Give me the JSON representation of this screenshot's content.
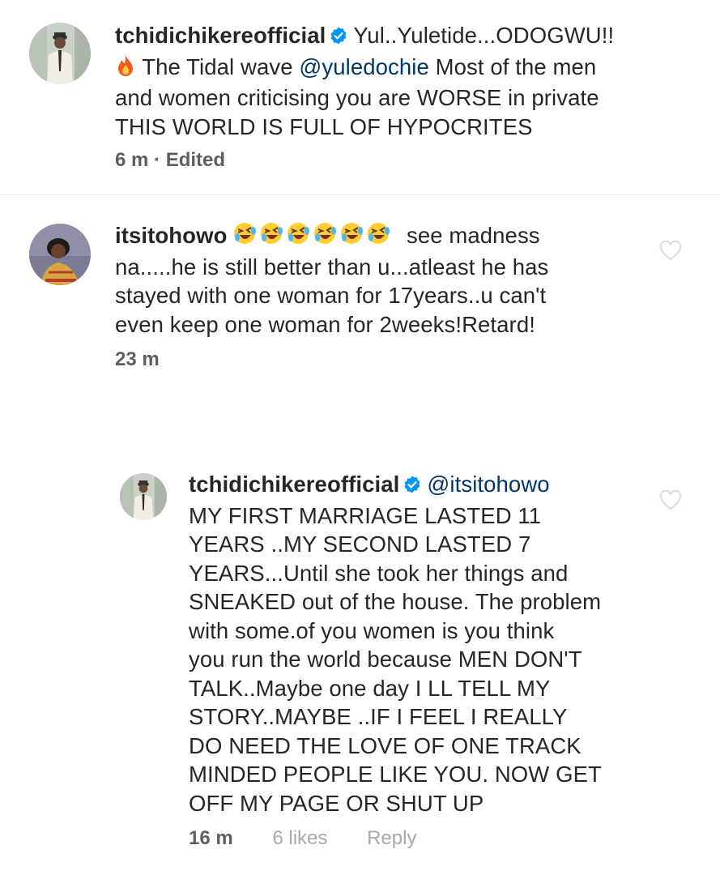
{
  "comments": [
    {
      "username": "tchidichikereofficial",
      "prefix": "Yul..Yuletide...ODOGWU!!",
      "emoji_icon": "fire-emoji",
      "text_before_mention": " The Tidal wave ",
      "mention": "@yuledochie",
      "text_after_mention_l1": "  Most of the men",
      "line2": "and women criticising you are WORSE in private",
      "line3": "THIS WORLD IS FULL OF HYPOCRITES",
      "time": "6 m",
      "sep": " · ",
      "edited": "Edited"
    },
    {
      "username": "itsitohowo",
      "emoji_icon": "rofl-emoji",
      "emoji_count": 6,
      "line1_rest": " see madness",
      "line2": "na.....he is still better than u...atleast he has",
      "line3": "stayed with one woman for 17years..u can't",
      "line4": "even keep one woman for 2weeks!Retard!",
      "time": "23 m"
    }
  ],
  "reply": {
    "username": "tchidichikereofficial",
    "mention": "@itsitohowo",
    "lines": [
      "MY FIRST MARRIAGE LASTED 11",
      "YEARS ..MY SECOND LASTED 7",
      "YEARS...Until she took her things and",
      "SNEAKED out of the house. The problem",
      "with some.of you women is you think",
      "you run the world because MEN DON'T",
      "TALK..Maybe one day I LL TELL MY",
      "STORY..MAYBE ..IF I FEEL I REALLY",
      "DO NEED THE LOVE OF ONE TRACK",
      "MINDED PEOPLE LIKE YOU. NOW GET",
      "OFF MY PAGE OR SHUT UP"
    ],
    "time": "16 m",
    "likes": "6 likes",
    "reply_label": "Reply"
  },
  "colors": {
    "text": "#262626",
    "mention": "#00376b",
    "meta": "#8e8e8e",
    "verified": "#0095f6"
  }
}
